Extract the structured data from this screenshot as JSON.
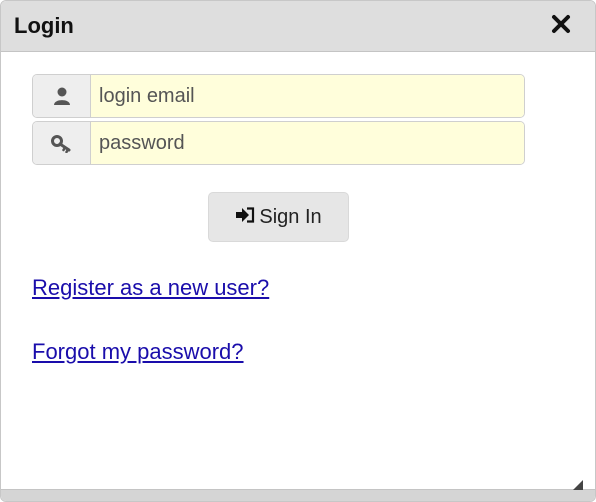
{
  "dialog": {
    "title": "Login",
    "close_icon": "close-icon"
  },
  "form": {
    "email": {
      "icon": "user-icon",
      "placeholder": "login email",
      "value": ""
    },
    "password": {
      "icon": "key-icon",
      "placeholder": "password",
      "value": ""
    },
    "signin": {
      "icon": "sign-in-icon",
      "label": "Sign In"
    }
  },
  "links": {
    "register": "Register as a new user?",
    "forgot": "Forgot my password?"
  },
  "colors": {
    "titlebar": "#dedede",
    "input_background": "#fffedb",
    "link": "#1a0dab",
    "button": "#e6e6e6"
  }
}
